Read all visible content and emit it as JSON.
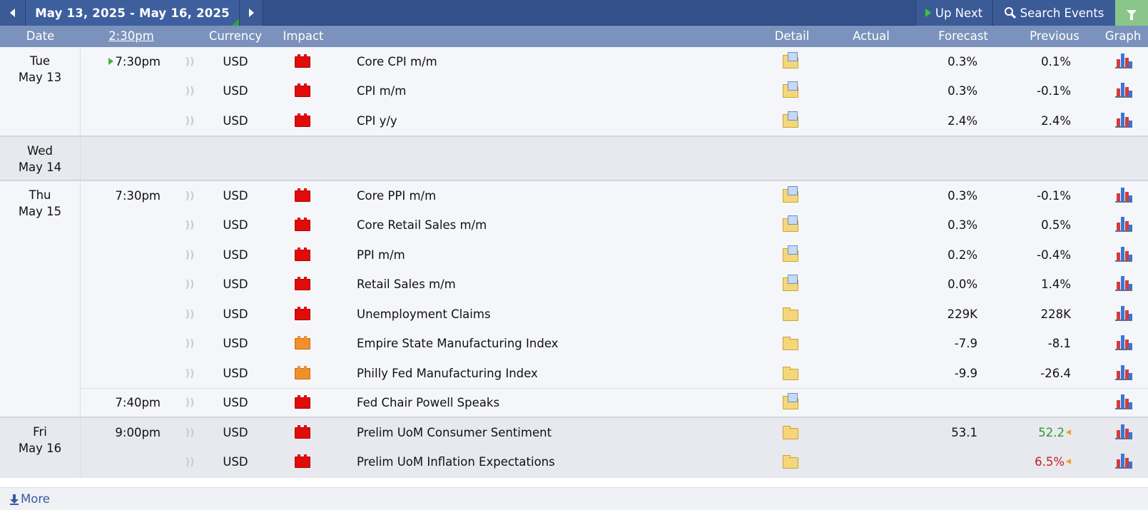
{
  "toolbar": {
    "date_range": "May 13, 2025 - May 16, 2025",
    "up_next_label": "Up Next",
    "search_label": "Search Events",
    "filter_color": "#8ac68a"
  },
  "header": {
    "date": "Date",
    "time": "2:30pm",
    "currency": "Currency",
    "impact": "Impact",
    "detail": "Detail",
    "actual": "Actual",
    "forecast": "Forecast",
    "previous": "Previous",
    "graph": "Graph"
  },
  "days": [
    {
      "weekday": "Tue",
      "date": "May 13"
    },
    {
      "weekday": "Wed",
      "date": "May 14"
    },
    {
      "weekday": "Thu",
      "date": "May 15"
    },
    {
      "weekday": "Fri",
      "date": "May 16"
    }
  ],
  "events": [
    {
      "time": "7:30pm",
      "current": true,
      "currency": "USD",
      "impact": "high",
      "event": "Core CPI m/m",
      "detail_icon": "open-folder-icon",
      "actual": "",
      "forecast": "0.3%",
      "previous": "0.1%"
    },
    {
      "time": "",
      "currency": "USD",
      "impact": "high",
      "event": "CPI m/m",
      "detail_icon": "open-folder-icon",
      "actual": "",
      "forecast": "0.3%",
      "previous": "-0.1%"
    },
    {
      "time": "",
      "currency": "USD",
      "impact": "high",
      "event": "CPI y/y",
      "detail_icon": "open-folder-icon",
      "actual": "",
      "forecast": "2.4%",
      "previous": "2.4%"
    },
    {
      "time": "7:30pm",
      "currency": "USD",
      "impact": "high",
      "event": "Core PPI m/m",
      "detail_icon": "open-folder-icon",
      "actual": "",
      "forecast": "0.3%",
      "previous": "-0.1%"
    },
    {
      "time": "",
      "currency": "USD",
      "impact": "high",
      "event": "Core Retail Sales m/m",
      "detail_icon": "open-folder-icon",
      "actual": "",
      "forecast": "0.3%",
      "previous": "0.5%"
    },
    {
      "time": "",
      "currency": "USD",
      "impact": "high",
      "event": "PPI m/m",
      "detail_icon": "open-folder-icon",
      "actual": "",
      "forecast": "0.2%",
      "previous": "-0.4%"
    },
    {
      "time": "",
      "currency": "USD",
      "impact": "high",
      "event": "Retail Sales m/m",
      "detail_icon": "open-folder-icon",
      "actual": "",
      "forecast": "0.0%",
      "previous": "1.4%"
    },
    {
      "time": "",
      "currency": "USD",
      "impact": "high",
      "event": "Unemployment Claims",
      "detail_icon": "folder-icon",
      "actual": "",
      "forecast": "229K",
      "previous": "228K"
    },
    {
      "time": "",
      "currency": "USD",
      "impact": "medium",
      "event": "Empire State Manufacturing Index",
      "detail_icon": "folder-icon",
      "actual": "",
      "forecast": "-7.9",
      "previous": "-8.1"
    },
    {
      "time": "",
      "currency": "USD",
      "impact": "medium",
      "event": "Philly Fed Manufacturing Index",
      "detail_icon": "folder-icon",
      "actual": "",
      "forecast": "-9.9",
      "previous": "-26.4"
    },
    {
      "time": "7:40pm",
      "currency": "USD",
      "impact": "high",
      "event": "Fed Chair Powell Speaks",
      "detail_icon": "open-folder-icon",
      "actual": "",
      "forecast": "",
      "previous": ""
    },
    {
      "time": "9:00pm",
      "currency": "USD",
      "impact": "high",
      "event": "Prelim UoM Consumer Sentiment",
      "detail_icon": "folder-icon",
      "actual": "",
      "forecast": "53.1",
      "previous": "52.2",
      "previous_status": "better"
    },
    {
      "time": "",
      "currency": "USD",
      "impact": "high",
      "event": "Prelim UoM Inflation Expectations",
      "detail_icon": "folder-icon",
      "actual": "",
      "forecast": "",
      "previous": "6.5%",
      "previous_status": "worse"
    }
  ],
  "impact_colors": {
    "high": "#e00b0b",
    "medium": "#f0902c"
  },
  "footer": {
    "more_label": "More"
  }
}
